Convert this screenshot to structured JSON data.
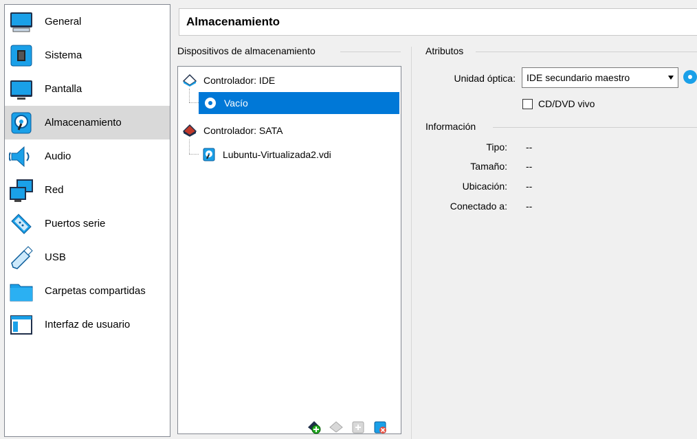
{
  "sidebar": {
    "items": [
      {
        "label": "General",
        "icon": "monitor-icon"
      },
      {
        "label": "Sistema",
        "icon": "chip-icon"
      },
      {
        "label": "Pantalla",
        "icon": "display-icon"
      },
      {
        "label": "Almacenamiento",
        "icon": "disk-icon",
        "selected": true
      },
      {
        "label": "Audio",
        "icon": "speaker-icon"
      },
      {
        "label": "Red",
        "icon": "network-icon"
      },
      {
        "label": "Puertos serie",
        "icon": "serial-port-icon"
      },
      {
        "label": "USB",
        "icon": "usb-icon"
      },
      {
        "label": "Carpetas compartidas",
        "icon": "folder-icon"
      },
      {
        "label": "Interfaz de usuario",
        "icon": "window-icon"
      }
    ]
  },
  "header": {
    "title": "Almacenamiento"
  },
  "storage": {
    "group_title": "Dispositivos de almacenamiento",
    "tree": [
      {
        "label": "Controlador: IDE",
        "type": "controller"
      },
      {
        "label": "Vacío",
        "type": "optical",
        "selected": true
      },
      {
        "label": "Controlador: SATA",
        "type": "controller"
      },
      {
        "label": "Lubuntu-Virtualizada2.vdi",
        "type": "hdd"
      }
    ]
  },
  "attributes": {
    "group_title": "Atributos",
    "optical_label": "Unidad óptica:",
    "optical_value": "IDE secundario maestro",
    "live_cd_label": "CD/DVD vivo"
  },
  "information": {
    "group_title": "Información",
    "rows": [
      {
        "key": "Tipo:",
        "value": "--"
      },
      {
        "key": "Tamaño:",
        "value": "--"
      },
      {
        "key": "Ubicación:",
        "value": "--"
      },
      {
        "key": "Conectado a:",
        "value": "--"
      }
    ]
  },
  "colors": {
    "selection": "#0078d7",
    "sidebar_selected": "#d9d9d9",
    "accent": "#1e90c8"
  }
}
